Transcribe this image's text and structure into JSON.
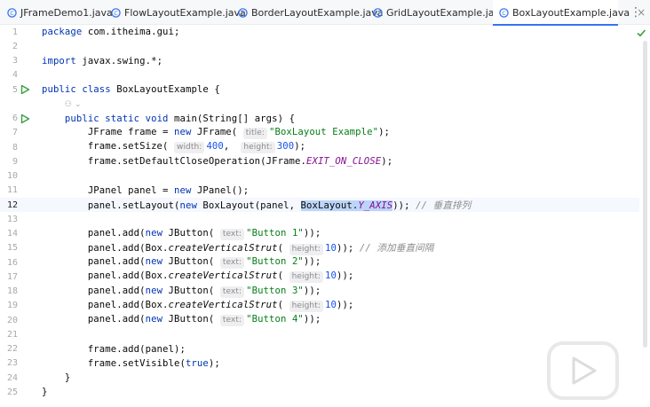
{
  "tabs": [
    {
      "label": "JFrameDemo1.java",
      "active": false
    },
    {
      "label": "FlowLayoutExample.java",
      "active": false
    },
    {
      "label": "BorderLayoutExample.java",
      "active": false
    },
    {
      "label": "GridLayoutExample.java",
      "active": false
    },
    {
      "label": "BoxLayoutExample.java",
      "active": true
    }
  ],
  "tab_close_glyph": "×",
  "more_glyph": "⋮",
  "colors": {
    "keyword": "#0033b3",
    "string": "#067d17",
    "number": "#1750eb",
    "constant": "#871094",
    "comment": "#8c8c8c",
    "selection": "#bcd5f8",
    "tab_accent": "#3574f0",
    "run_icon": "#3a9e43",
    "file_icon": "#3574f0"
  },
  "icons": {
    "file": "java-class-icon",
    "run": "run-gutter-icon",
    "status": "inspection-ok-checkmark-icon",
    "overlay": "video-play-icon"
  },
  "editor": {
    "current_line": 12,
    "lines": [
      {
        "n": "1",
        "tokens": [
          {
            "t": "package",
            "c": "kw"
          },
          {
            "t": " com.itheima.gui;"
          }
        ]
      },
      {
        "n": "2",
        "tokens": []
      },
      {
        "n": "3",
        "tokens": [
          {
            "t": "import",
            "c": "kw"
          },
          {
            "t": " javax.swing.*;"
          }
        ]
      },
      {
        "n": "4",
        "tokens": []
      },
      {
        "n": "5",
        "run": true,
        "tokens": [
          {
            "t": "public class",
            "c": "kw"
          },
          {
            "t": " BoxLayoutExample {"
          }
        ]
      },
      {
        "n": "",
        "lens": "⚇ ⌄",
        "tokens": [
          {
            "t": "    "
          },
          {
            "t": "⚇ ⌄",
            "c": "lens"
          }
        ]
      },
      {
        "n": "6",
        "run": true,
        "tokens": [
          {
            "t": "    "
          },
          {
            "t": "public static void",
            "c": "kw"
          },
          {
            "t": " main(String[] args) {"
          }
        ]
      },
      {
        "n": "7",
        "tokens": [
          {
            "t": "        JFrame frame = "
          },
          {
            "t": "new",
            "c": "kw"
          },
          {
            "t": " JFrame( "
          },
          {
            "t": "title:",
            "c": "hint"
          },
          {
            "t": "\"BoxLayout Example\"",
            "c": "str"
          },
          {
            "t": ");"
          }
        ]
      },
      {
        "n": "8",
        "tokens": [
          {
            "t": "        frame.setSize( "
          },
          {
            "t": "width:",
            "c": "hint"
          },
          {
            "t": "400",
            "c": "num"
          },
          {
            "t": ",  "
          },
          {
            "t": "height:",
            "c": "hint"
          },
          {
            "t": "300",
            "c": "num"
          },
          {
            "t": ");"
          }
        ]
      },
      {
        "n": "9",
        "tokens": [
          {
            "t": "        frame.setDefaultCloseOperation(JFrame."
          },
          {
            "t": "EXIT_ON_CLOSE",
            "c": "const"
          },
          {
            "t": ");"
          }
        ]
      },
      {
        "n": "10",
        "tokens": []
      },
      {
        "n": "11",
        "tokens": [
          {
            "t": "        JPanel panel = "
          },
          {
            "t": "new",
            "c": "kw"
          },
          {
            "t": " JPanel();"
          }
        ]
      },
      {
        "n": "12",
        "tokens": [
          {
            "t": "        panel.setLayout("
          },
          {
            "t": "new",
            "c": "kw"
          },
          {
            "t": " BoxLayout(panel, "
          },
          {
            "t": "BoxLayout.",
            "c": "sel"
          },
          {
            "t": "Y_AXIS",
            "c": "const sel"
          },
          {
            "t": ")); "
          },
          {
            "t": "// 垂直排列",
            "c": "cmt"
          }
        ]
      },
      {
        "n": "13",
        "tokens": []
      },
      {
        "n": "14",
        "tokens": [
          {
            "t": "        panel.add("
          },
          {
            "t": "new",
            "c": "kw"
          },
          {
            "t": " JButton( "
          },
          {
            "t": "text:",
            "c": "hint"
          },
          {
            "t": "\"Button 1\"",
            "c": "str"
          },
          {
            "t": "));"
          }
        ]
      },
      {
        "n": "15",
        "tokens": [
          {
            "t": "        panel.add(Box."
          },
          {
            "t": "createVerticalStrut",
            "c": "static"
          },
          {
            "t": "( "
          },
          {
            "t": "height:",
            "c": "hint"
          },
          {
            "t": "10",
            "c": "num"
          },
          {
            "t": ")); "
          },
          {
            "t": "// 添加垂直间隔",
            "c": "cmt"
          }
        ]
      },
      {
        "n": "16",
        "tokens": [
          {
            "t": "        panel.add("
          },
          {
            "t": "new",
            "c": "kw"
          },
          {
            "t": " JButton( "
          },
          {
            "t": "text:",
            "c": "hint"
          },
          {
            "t": "\"Button 2\"",
            "c": "str"
          },
          {
            "t": "));"
          }
        ]
      },
      {
        "n": "17",
        "tokens": [
          {
            "t": "        panel.add(Box."
          },
          {
            "t": "createVerticalStrut",
            "c": "static"
          },
          {
            "t": "( "
          },
          {
            "t": "height:",
            "c": "hint"
          },
          {
            "t": "10",
            "c": "num"
          },
          {
            "t": "));"
          }
        ]
      },
      {
        "n": "18",
        "tokens": [
          {
            "t": "        panel.add("
          },
          {
            "t": "new",
            "c": "kw"
          },
          {
            "t": " JButton( "
          },
          {
            "t": "text:",
            "c": "hint"
          },
          {
            "t": "\"Button 3\"",
            "c": "str"
          },
          {
            "t": "));"
          }
        ]
      },
      {
        "n": "19",
        "tokens": [
          {
            "t": "        panel.add(Box."
          },
          {
            "t": "createVerticalStrut",
            "c": "static"
          },
          {
            "t": "( "
          },
          {
            "t": "height:",
            "c": "hint"
          },
          {
            "t": "10",
            "c": "num"
          },
          {
            "t": "));"
          }
        ]
      },
      {
        "n": "20",
        "tokens": [
          {
            "t": "        panel.add("
          },
          {
            "t": "new",
            "c": "kw"
          },
          {
            "t": " JButton( "
          },
          {
            "t": "text:",
            "c": "hint"
          },
          {
            "t": "\"Button 4\"",
            "c": "str"
          },
          {
            "t": "));"
          }
        ]
      },
      {
        "n": "21",
        "tokens": []
      },
      {
        "n": "22",
        "tokens": [
          {
            "t": "        frame.add(panel);"
          }
        ]
      },
      {
        "n": "23",
        "tokens": [
          {
            "t": "        frame.setVisible("
          },
          {
            "t": "true",
            "c": "kw"
          },
          {
            "t": ");"
          }
        ]
      },
      {
        "n": "24",
        "tokens": [
          {
            "t": "    }"
          }
        ]
      },
      {
        "n": "25",
        "tokens": [
          {
            "t": "}"
          }
        ]
      }
    ]
  }
}
